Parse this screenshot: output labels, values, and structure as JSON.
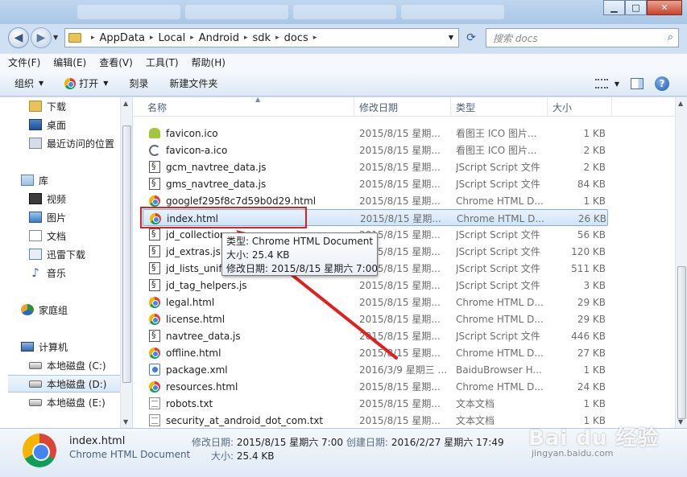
{
  "window": {
    "minimize": "▁",
    "maximize": "□",
    "close": "✕"
  },
  "address": {
    "crumbs": [
      "AppData",
      "Local",
      "Android",
      "sdk",
      "docs"
    ],
    "search_placeholder": "搜索 docs"
  },
  "menu": [
    "文件(F)",
    "编辑(E)",
    "查看(V)",
    "工具(T)",
    "帮助(H)"
  ],
  "toolbar": {
    "organize": "组织",
    "open": "打开",
    "burn": "刻录",
    "new_folder": "新建文件夹"
  },
  "nav": {
    "items": [
      {
        "label": "下载",
        "icon": "folder-icon"
      },
      {
        "label": "桌面",
        "icon": "desktop-icon"
      },
      {
        "label": "最近访问的位置",
        "icon": "recent-icon"
      },
      {
        "label": "库",
        "icon": "library-icon"
      },
      {
        "label": "视频",
        "icon": "video-icon"
      },
      {
        "label": "图片",
        "icon": "picture-icon"
      },
      {
        "label": "文档",
        "icon": "document-icon"
      },
      {
        "label": "迅雷下载",
        "icon": "download-icon"
      },
      {
        "label": "音乐",
        "icon": "music-icon"
      },
      {
        "label": "家庭组",
        "icon": "homegroup-icon"
      },
      {
        "label": "计算机",
        "icon": "computer-icon"
      },
      {
        "label": "本地磁盘 (C:)",
        "icon": "disk-icon"
      },
      {
        "label": "本地磁盘 (D:)",
        "icon": "disk-icon"
      },
      {
        "label": "本地磁盘 (E:)",
        "icon": "disk-icon"
      }
    ]
  },
  "columns": {
    "name": "名称",
    "date": "修改日期",
    "type": "类型",
    "size": "大小"
  },
  "files": [
    {
      "name": "favicon.ico",
      "date": "2015/8/15 星期...",
      "type": "看图王 ICO 图片...",
      "size": "1 KB",
      "icon": "android"
    },
    {
      "name": "favicon-a.ico",
      "date": "2015/8/15 星期...",
      "type": "看图王 ICO 图片...",
      "size": "2 KB",
      "icon": "crescent"
    },
    {
      "name": "gcm_navtree_data.js",
      "date": "2015/8/15 星期...",
      "type": "JScript Script 文件",
      "size": "2 KB",
      "icon": "js"
    },
    {
      "name": "gms_navtree_data.js",
      "date": "2015/8/15 星期...",
      "type": "JScript Script 文件",
      "size": "84 KB",
      "icon": "js"
    },
    {
      "name": "googlef295f8c7d59b0d29.html",
      "date": "2015/8/15 星期...",
      "type": "Chrome HTML D...",
      "size": "1 KB",
      "icon": "chrome"
    },
    {
      "name": "index.html",
      "date": "2015/8/15 星期...",
      "type": "Chrome HTML D...",
      "size": "26 KB",
      "icon": "chrome"
    },
    {
      "name": "jd_collection",
      "date": "2015/8/15 星期...",
      "type": "JScript Script 文件",
      "size": "56 KB",
      "icon": "js"
    },
    {
      "name": "jd_extras.js",
      "date": "2015/8/15 星期...",
      "type": "JScript Script 文件",
      "size": "120 KB",
      "icon": "js"
    },
    {
      "name": "jd_lists_unifi",
      "date": "2015/8/15 星期...",
      "type": "JScript Script 文件",
      "size": "511 KB",
      "icon": "js"
    },
    {
      "name": "jd_tag_helpers.js",
      "date": "2015/8/15 星期...",
      "type": "JScript Script 文件",
      "size": "3 KB",
      "icon": "js"
    },
    {
      "name": "legal.html",
      "date": "2015/8/15 星期...",
      "type": "Chrome HTML D...",
      "size": "29 KB",
      "icon": "chrome"
    },
    {
      "name": "license.html",
      "date": "2015/8/15 星期...",
      "type": "Chrome HTML D...",
      "size": "29 KB",
      "icon": "chrome"
    },
    {
      "name": "navtree_data.js",
      "date": "2015/8/15 星期...",
      "type": "JScript Script 文件",
      "size": "446 KB",
      "icon": "js"
    },
    {
      "name": "offline.html",
      "date": "2015/8/15 星期...",
      "type": "Chrome HTML D...",
      "size": "27 KB",
      "icon": "chrome"
    },
    {
      "name": "package.xml",
      "date": "2016/3/9 星期三 ...",
      "type": "BaiduBrowser H...",
      "size": "1 KB",
      "icon": "baidu"
    },
    {
      "name": "resources.html",
      "date": "2015/8/15 星期...",
      "type": "Chrome HTML D...",
      "size": "24 KB",
      "icon": "chrome"
    },
    {
      "name": "robots.txt",
      "date": "2015/8/15 星期...",
      "type": "文本文档",
      "size": "1 KB",
      "icon": "txt"
    },
    {
      "name": "security_at_android_dot_com.txt",
      "date": "2015/8/15 星期...",
      "type": "文本文档",
      "size": "1 KB",
      "icon": "txt"
    }
  ],
  "tooltip": {
    "type": "类型: Chrome HTML Document",
    "size": "大小: 25.4 KB",
    "modified": "修改日期: 2015/8/15 星期六 7:00"
  },
  "details": {
    "name": "index.html",
    "type": "Chrome HTML Document",
    "modified_label": "修改日期:",
    "modified": "2015/8/15 星期六 7:00",
    "created_label": "创建日期:",
    "created": "2016/2/27 星期六 17:49",
    "size_label": "大小:",
    "size": "25.4 KB"
  },
  "watermark": {
    "main": "Bai du 经验",
    "sub": "jingyan.baidu.com"
  },
  "colors": {
    "highlight": "#e02020",
    "accent": "#84acdd"
  }
}
